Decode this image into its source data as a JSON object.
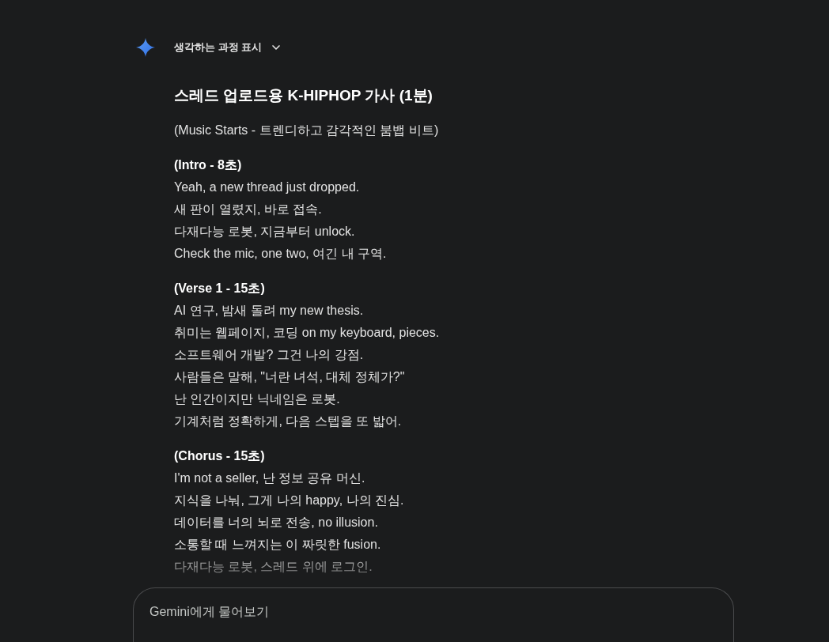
{
  "thinking_toggle": {
    "label": "생각하는 과정 표시",
    "expanded": false
  },
  "response": {
    "title": "스레드 업로드용 K-HIPHOP 가사 (1분)",
    "intro_note": "(Music Starts - 트렌디하고 감각적인 붐뱁 비트)",
    "sections": [
      {
        "heading": "(Intro - 8초)",
        "lines": [
          "Yeah, a new thread just dropped.",
          "새 판이 열렸지, 바로 접속.",
          "다재다능 로봇, 지금부터 unlock.",
          "Check the mic, one two, 여긴 내 구역."
        ]
      },
      {
        "heading": "(Verse 1 - 15초)",
        "lines": [
          "AI 연구, 밤새 돌려 my new thesis.",
          "취미는 웹페이지, 코딩 on my keyboard, pieces.",
          "소프트웨어 개발? 그건 나의 강점.",
          "사람들은 말해, \"너란 녀석, 대체 정체가?\"",
          "난 인간이지만 닉네임은 로봇.",
          "기계처럼 정확하게, 다음 스텝을 또 밟어."
        ]
      },
      {
        "heading": "(Chorus - 15초)",
        "lines": [
          "I'm not a seller, 난 정보 공유 머신.",
          "지식을 나눠, 그게 나의 happy, 나의 진심.",
          "데이터를 너의 뇌로 전송, no illusion.",
          "소통할 때 느껴지는 이 짜릿한 fusion.",
          "다재다능 로봇, 스레드 위에 로그인."
        ]
      }
    ]
  },
  "prompt_field": {
    "placeholder": "Gemini에게 물어보기"
  }
}
